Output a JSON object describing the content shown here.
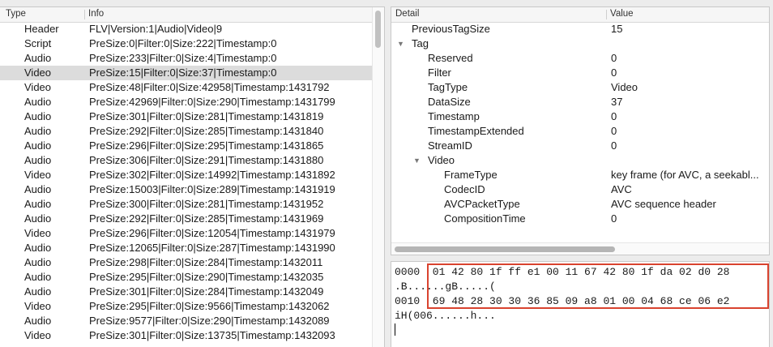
{
  "left_table": {
    "columns": [
      "Type",
      "Info"
    ],
    "rows": [
      {
        "type": "Header",
        "info": "FLV|Version:1|Audio|Video|9"
      },
      {
        "type": "Script",
        "info": "PreSize:0|Filter:0|Size:222|Timestamp:0"
      },
      {
        "type": "Audio",
        "info": "PreSize:233|Filter:0|Size:4|Timestamp:0"
      },
      {
        "type": "Video",
        "info": "PreSize:15|Filter:0|Size:37|Timestamp:0",
        "selected": true
      },
      {
        "type": "Video",
        "info": "PreSize:48|Filter:0|Size:42958|Timestamp:1431792"
      },
      {
        "type": "Audio",
        "info": "PreSize:42969|Filter:0|Size:290|Timestamp:1431799"
      },
      {
        "type": "Audio",
        "info": "PreSize:301|Filter:0|Size:281|Timestamp:1431819"
      },
      {
        "type": "Audio",
        "info": "PreSize:292|Filter:0|Size:285|Timestamp:1431840"
      },
      {
        "type": "Audio",
        "info": "PreSize:296|Filter:0|Size:295|Timestamp:1431865"
      },
      {
        "type": "Audio",
        "info": "PreSize:306|Filter:0|Size:291|Timestamp:1431880"
      },
      {
        "type": "Video",
        "info": "PreSize:302|Filter:0|Size:14992|Timestamp:1431892"
      },
      {
        "type": "Audio",
        "info": "PreSize:15003|Filter:0|Size:289|Timestamp:1431919"
      },
      {
        "type": "Audio",
        "info": "PreSize:300|Filter:0|Size:281|Timestamp:1431952"
      },
      {
        "type": "Audio",
        "info": "PreSize:292|Filter:0|Size:285|Timestamp:1431969"
      },
      {
        "type": "Video",
        "info": "PreSize:296|Filter:0|Size:12054|Timestamp:1431979"
      },
      {
        "type": "Audio",
        "info": "PreSize:12065|Filter:0|Size:287|Timestamp:1431990"
      },
      {
        "type": "Audio",
        "info": "PreSize:298|Filter:0|Size:284|Timestamp:1432011"
      },
      {
        "type": "Audio",
        "info": "PreSize:295|Filter:0|Size:290|Timestamp:1432035"
      },
      {
        "type": "Audio",
        "info": "PreSize:301|Filter:0|Size:284|Timestamp:1432049"
      },
      {
        "type": "Video",
        "info": "PreSize:295|Filter:0|Size:9566|Timestamp:1432062"
      },
      {
        "type": "Audio",
        "info": "PreSize:9577|Filter:0|Size:290|Timestamp:1432089"
      },
      {
        "type": "Video",
        "info": "PreSize:301|Filter:0|Size:13735|Timestamp:1432093"
      }
    ]
  },
  "detail_table": {
    "columns": [
      "Detail",
      "Value"
    ],
    "rows": [
      {
        "label": "PreviousTagSize",
        "value": "15",
        "level": 0
      },
      {
        "label": "Tag",
        "value": "",
        "level": 0,
        "expanded": true
      },
      {
        "label": "Reserved",
        "value": "0",
        "level": 1
      },
      {
        "label": "Filter",
        "value": "0",
        "level": 1
      },
      {
        "label": "TagType",
        "value": "Video",
        "level": 1
      },
      {
        "label": "DataSize",
        "value": "37",
        "level": 1
      },
      {
        "label": "Timestamp",
        "value": "0",
        "level": 1
      },
      {
        "label": "TimestampExtended",
        "value": "0",
        "level": 1
      },
      {
        "label": "StreamID",
        "value": "0",
        "level": 1
      },
      {
        "label": "Video",
        "value": "",
        "level": 1,
        "expanded": true
      },
      {
        "label": "FrameType",
        "value": "key frame (for AVC, a seekabl...",
        "level": 2
      },
      {
        "label": "CodecID",
        "value": "AVC",
        "level": 2
      },
      {
        "label": "AVCPacketType",
        "value": "AVC sequence header",
        "level": 2
      },
      {
        "label": "CompositionTime",
        "value": "0",
        "level": 2
      }
    ]
  },
  "hex_view": {
    "lines": [
      "0000  01 42 80 1f ff e1 00 11 67 42 80 1f da 02 d0 28",
      ".B......gB.....(",
      "0010  69 48 28 30 30 36 85 09 a8 01 00 04 68 ce 06 e2",
      "iH(006......h..."
    ],
    "highlight_color": "#d9432f"
  },
  "colors": {
    "selected_row": "#dcdcdc",
    "pane_bg": "#ffffff",
    "window_bg": "#ececec"
  }
}
